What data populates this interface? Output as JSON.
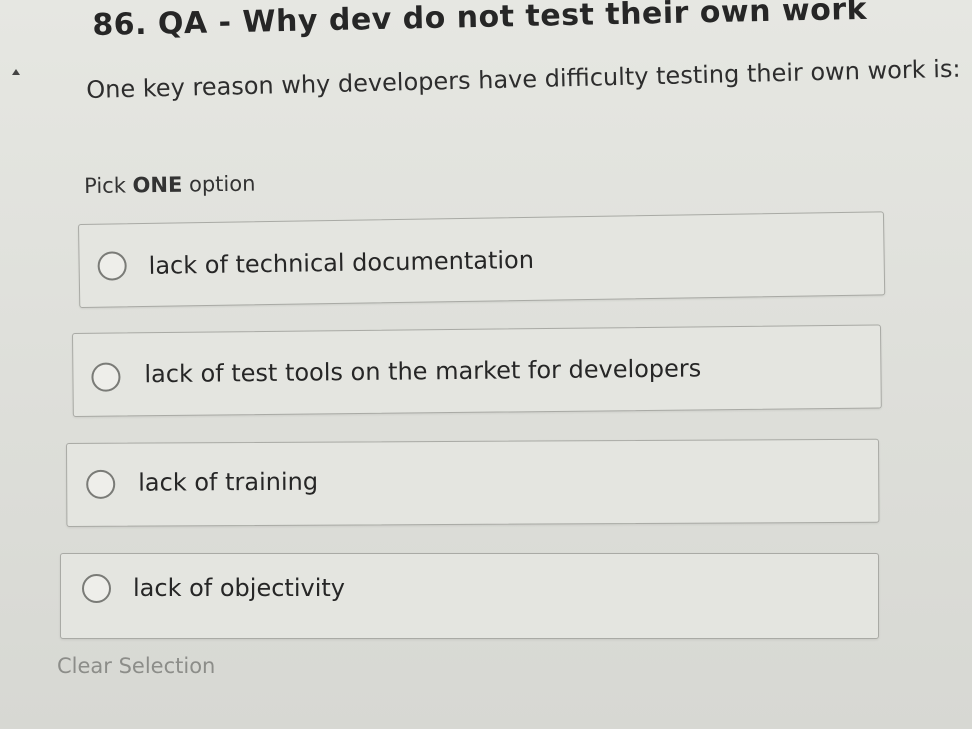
{
  "question": {
    "title": "86. QA - Why dev do not test their own work",
    "prompt": "One key reason why developers have difficulty testing their own work is:",
    "instruction_prefix": "Pick ",
    "instruction_emphasis": "ONE",
    "instruction_suffix": " option"
  },
  "options": [
    {
      "label": "lack of technical documentation",
      "selected": false
    },
    {
      "label": "lack of test tools on the market for developers",
      "selected": false
    },
    {
      "label": "lack of training",
      "selected": false
    },
    {
      "label": "lack of objectivity",
      "selected": false
    }
  ],
  "actions": {
    "clear_label": "Clear Selection"
  },
  "colors": {
    "background": "#e0e1dc",
    "text": "#262626",
    "muted": "#8c8d89",
    "border": "#a9aaa5"
  }
}
